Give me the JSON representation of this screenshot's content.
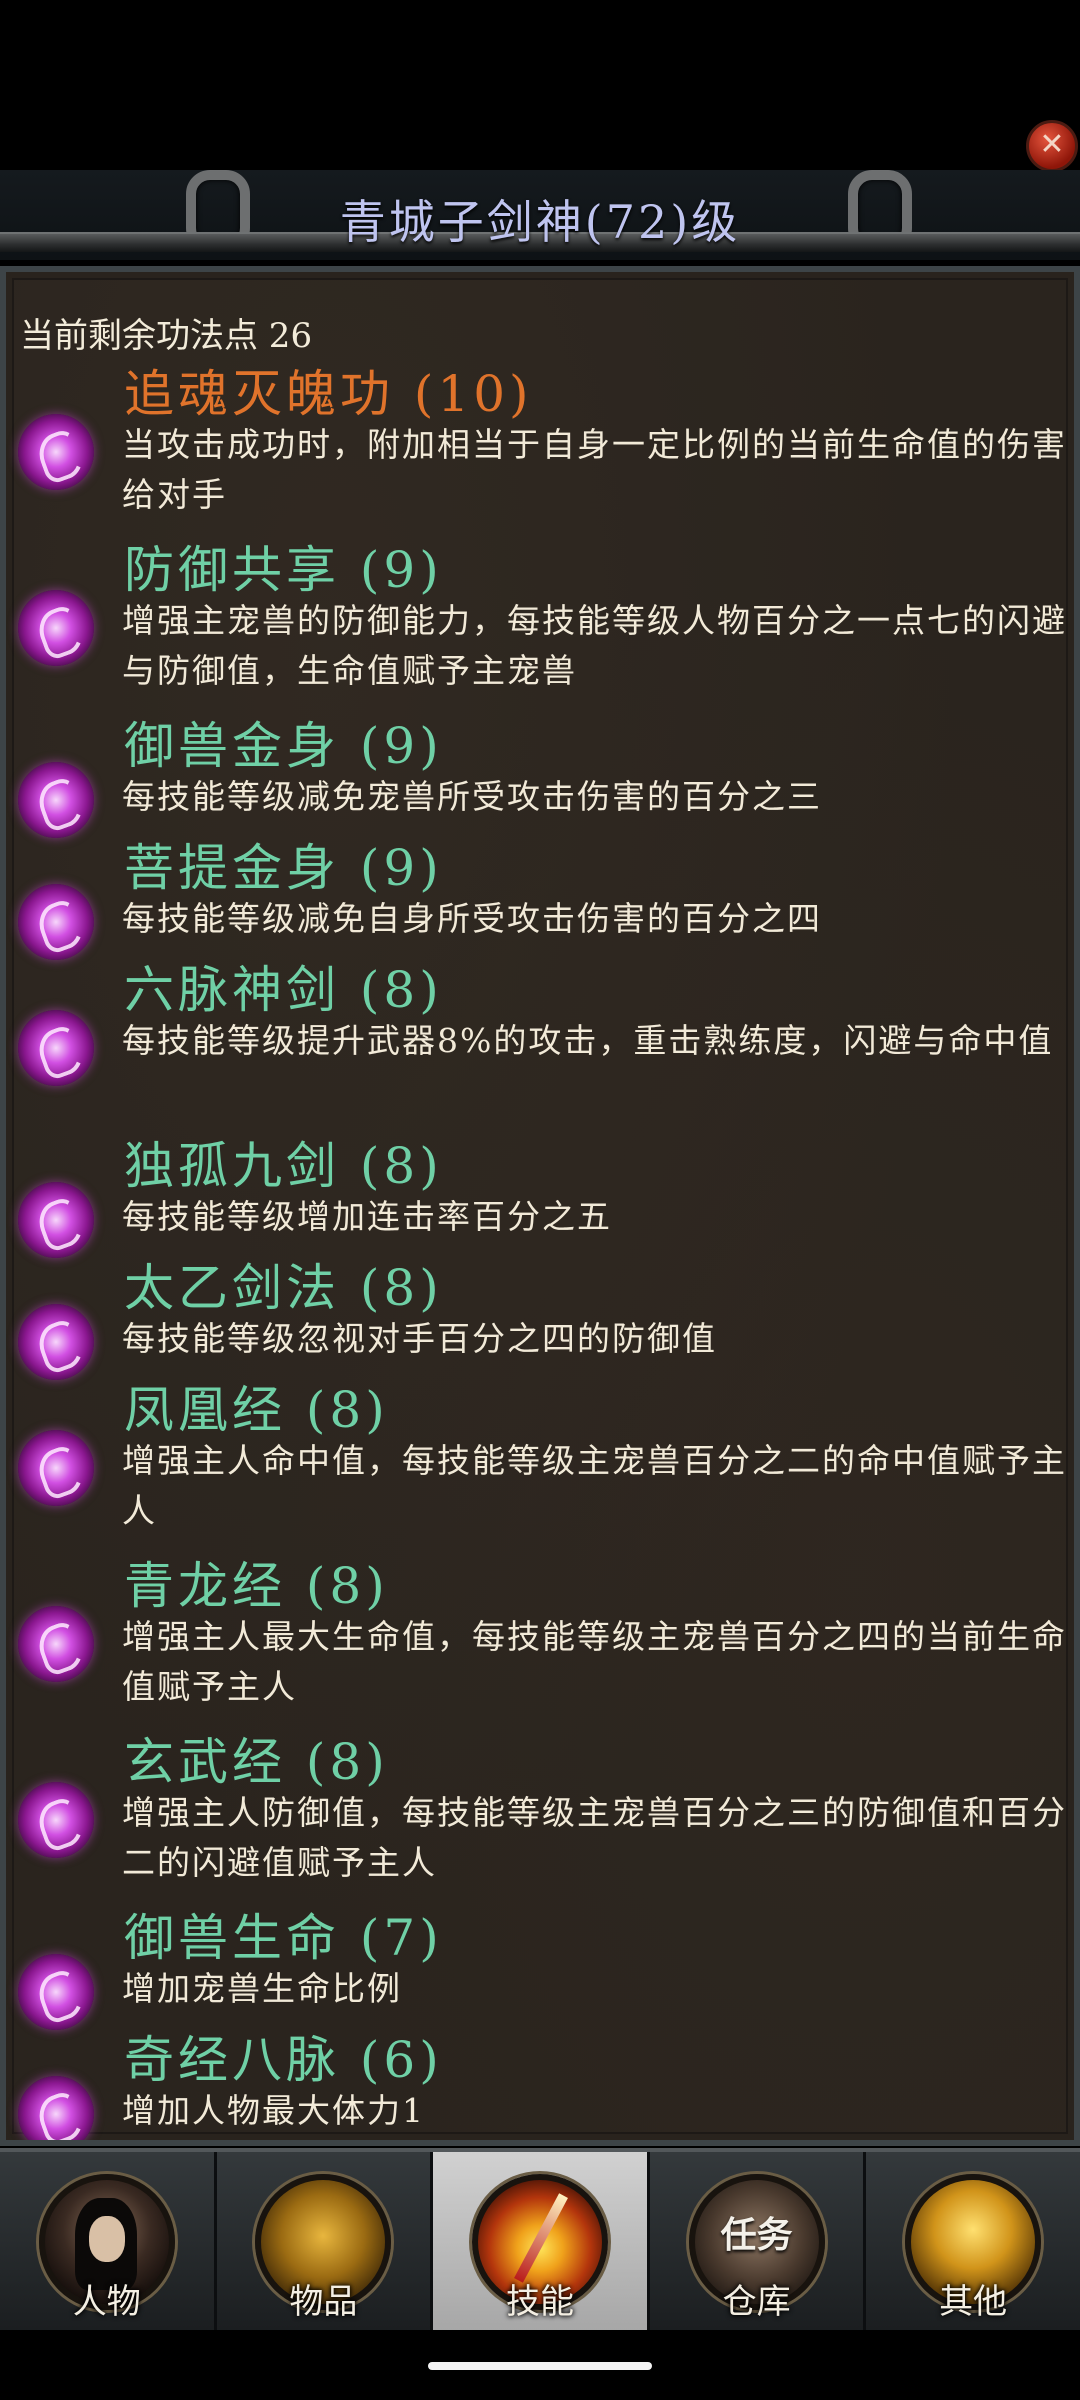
{
  "window": {
    "title": "青城子剑神(72)级",
    "close_label": "✕"
  },
  "panel": {
    "points_label": "当前剩余功法点 26"
  },
  "skills": [
    {
      "name": "追魂灭魄功 (10)",
      "desc": "当攻击成功时，附加相当于自身一定比例的当前生命值的伤害给对手",
      "active": true
    },
    {
      "name": "防御共享 (9)",
      "desc": "增强主宠兽的防御能力，每技能等级人物百分之一点七的闪避与防御值，生命值赋予主宠兽",
      "active": false
    },
    {
      "name": "御兽金身 (9)",
      "desc": "每技能等级减免宠兽所受攻击伤害的百分之三",
      "active": false
    },
    {
      "name": "菩提金身 (9)",
      "desc": "每技能等级减免自身所受攻击伤害的百分之四",
      "active": false
    },
    {
      "name": "六脉神剑 (8)",
      "desc": "每技能等级提升武器8%的攻击，重击熟练度，闪避与命中值",
      "active": false
    },
    {
      "name": "独孤九剑 (8)",
      "desc": "每技能等级增加连击率百分之五",
      "active": false
    },
    {
      "name": "太乙剑法 (8)",
      "desc": "每技能等级忽视对手百分之四的防御值",
      "active": false
    },
    {
      "name": "凤凰经 (8)",
      "desc": "增强主人命中值，每技能等级主宠兽百分之二的命中值赋予主人",
      "active": false
    },
    {
      "name": "青龙经 (8)",
      "desc": "增强主人最大生命值，每技能等级主宠兽百分之四的当前生命值赋予主人",
      "active": false
    },
    {
      "name": "玄武经 (8)",
      "desc": "增强主人防御值，每技能等级主宠兽百分之三的防御值和百分二的闪避值赋予主人",
      "active": false
    },
    {
      "name": "御兽生命 (7)",
      "desc": "增加宠兽生命比例",
      "active": false
    },
    {
      "name": "奇经八脉 (6)",
      "desc": "增加人物最大体力1",
      "active": false
    }
  ],
  "tabs": [
    {
      "label": "人物",
      "icon": "character-portrait-icon",
      "active": false
    },
    {
      "label": "物品",
      "icon": "golden-armor-icon",
      "active": false
    },
    {
      "label": "技能",
      "icon": "sword-burst-icon",
      "active": true
    },
    {
      "label": "仓库",
      "icon": "task-chest-icon",
      "badge": "任务",
      "active": false
    },
    {
      "label": "其他",
      "icon": "golden-trophy-icon",
      "active": false
    }
  ]
}
